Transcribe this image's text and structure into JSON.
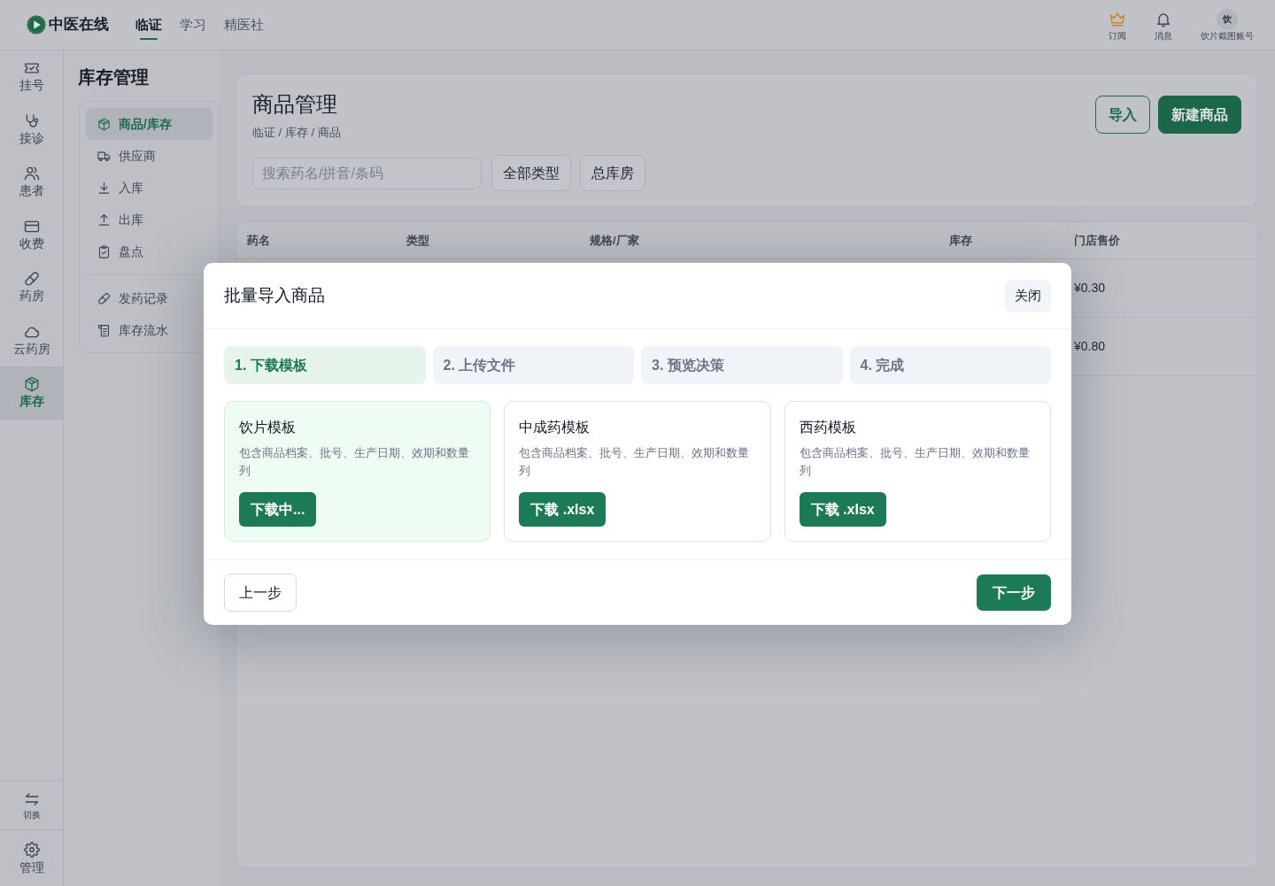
{
  "topbar": {
    "logo": "中医在线",
    "nav": [
      {
        "label": "临证",
        "selected": true
      },
      {
        "label": "学习",
        "selected": false
      },
      {
        "label": "精医社",
        "selected": false
      }
    ],
    "actions": [
      {
        "label": "订阅"
      },
      {
        "label": "消息"
      }
    ],
    "account": {
      "avatar": "饮",
      "label": "饮片截图账号"
    }
  },
  "rail": {
    "items": [
      {
        "label": "挂号",
        "selected": false
      },
      {
        "label": "接诊",
        "selected": false
      },
      {
        "label": "患者",
        "selected": false
      },
      {
        "label": "收费",
        "selected": false
      },
      {
        "label": "药房",
        "selected": false
      },
      {
        "label": "云药房",
        "selected": false
      },
      {
        "label": "库存",
        "selected": true
      }
    ],
    "bottom": [
      {
        "label": "切换"
      },
      {
        "label": "管理"
      }
    ]
  },
  "subnav": {
    "title": "库存管理",
    "groups": [
      {
        "items": [
          {
            "label": "商品/库存",
            "selected": true
          },
          {
            "label": "供应商",
            "selected": false
          },
          {
            "label": "入库",
            "selected": false
          },
          {
            "label": "出库",
            "selected": false
          },
          {
            "label": "盘点",
            "selected": false
          }
        ]
      },
      {
        "items": [
          {
            "label": "发药记录",
            "selected": false
          },
          {
            "label": "库存流水",
            "selected": false
          }
        ]
      }
    ]
  },
  "page": {
    "title": "商品管理",
    "breadcrumb": "临证 / 库存 / 商品",
    "search": {
      "placeholder": "搜索药名/拼音/条码"
    },
    "filters": [
      "全部类型",
      "总库房"
    ],
    "actions": [
      {
        "label": "导入",
        "kind": "outline"
      },
      {
        "label": "新建商品",
        "kind": "primary"
      }
    ]
  },
  "table": {
    "columns": [
      "药名",
      "类型",
      "规格/厂家",
      "库存",
      "门店售价"
    ],
    "rows": [
      {
        "store_price": "¥0.30"
      },
      {
        "store_price": "¥0.80"
      }
    ]
  },
  "dialog": {
    "title": "批量导入商品",
    "close": "关闭",
    "steps": [
      {
        "label": "1. 下载模板",
        "selected": true
      },
      {
        "label": "2. 上传文件",
        "selected": false
      },
      {
        "label": "3. 预览决策",
        "selected": false
      },
      {
        "label": "4. 完成",
        "selected": false
      }
    ],
    "templates": [
      {
        "title": "饮片模板",
        "description": "包含商品档案、批号、生产日期、效期和数量列",
        "button": "下载中...",
        "selected": true
      },
      {
        "title": "中成药模板",
        "description": "包含商品档案、批号、生产日期、效期和数量列",
        "button": "下载 .xlsx",
        "selected": false
      },
      {
        "title": "西药模板",
        "description": "包含商品档案、批号、生产日期、效期和数量列",
        "button": "下载 .xlsx",
        "selected": false
      }
    ],
    "back": "上一步",
    "next": "下一步"
  }
}
